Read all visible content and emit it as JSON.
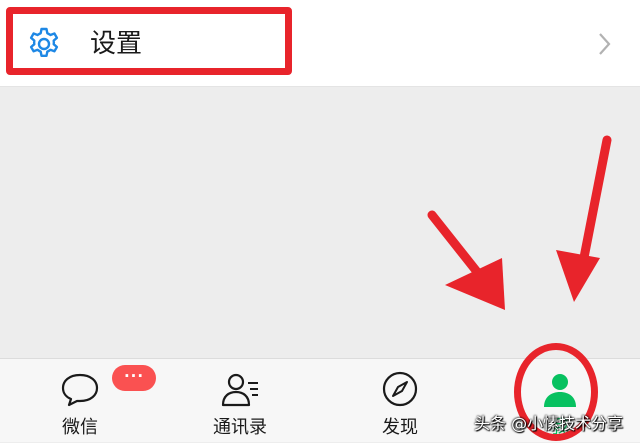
{
  "settings": {
    "label": "设置",
    "icon": "gear-icon",
    "chevron_icon": "chevron-right-icon"
  },
  "tabbar": {
    "tabs": [
      {
        "label": "微信",
        "icon": "chat-bubble-icon",
        "badge": "···"
      },
      {
        "label": "通讯录",
        "icon": "contacts-icon"
      },
      {
        "label": "发现",
        "icon": "compass-icon"
      },
      {
        "label": "我",
        "icon": "person-icon",
        "active": true
      }
    ]
  },
  "annotations": {
    "highlight_color": "#e8242b",
    "active_color": "#07c160",
    "badge_color": "#fa5151"
  },
  "watermark": "头条 @小愫技术分享"
}
